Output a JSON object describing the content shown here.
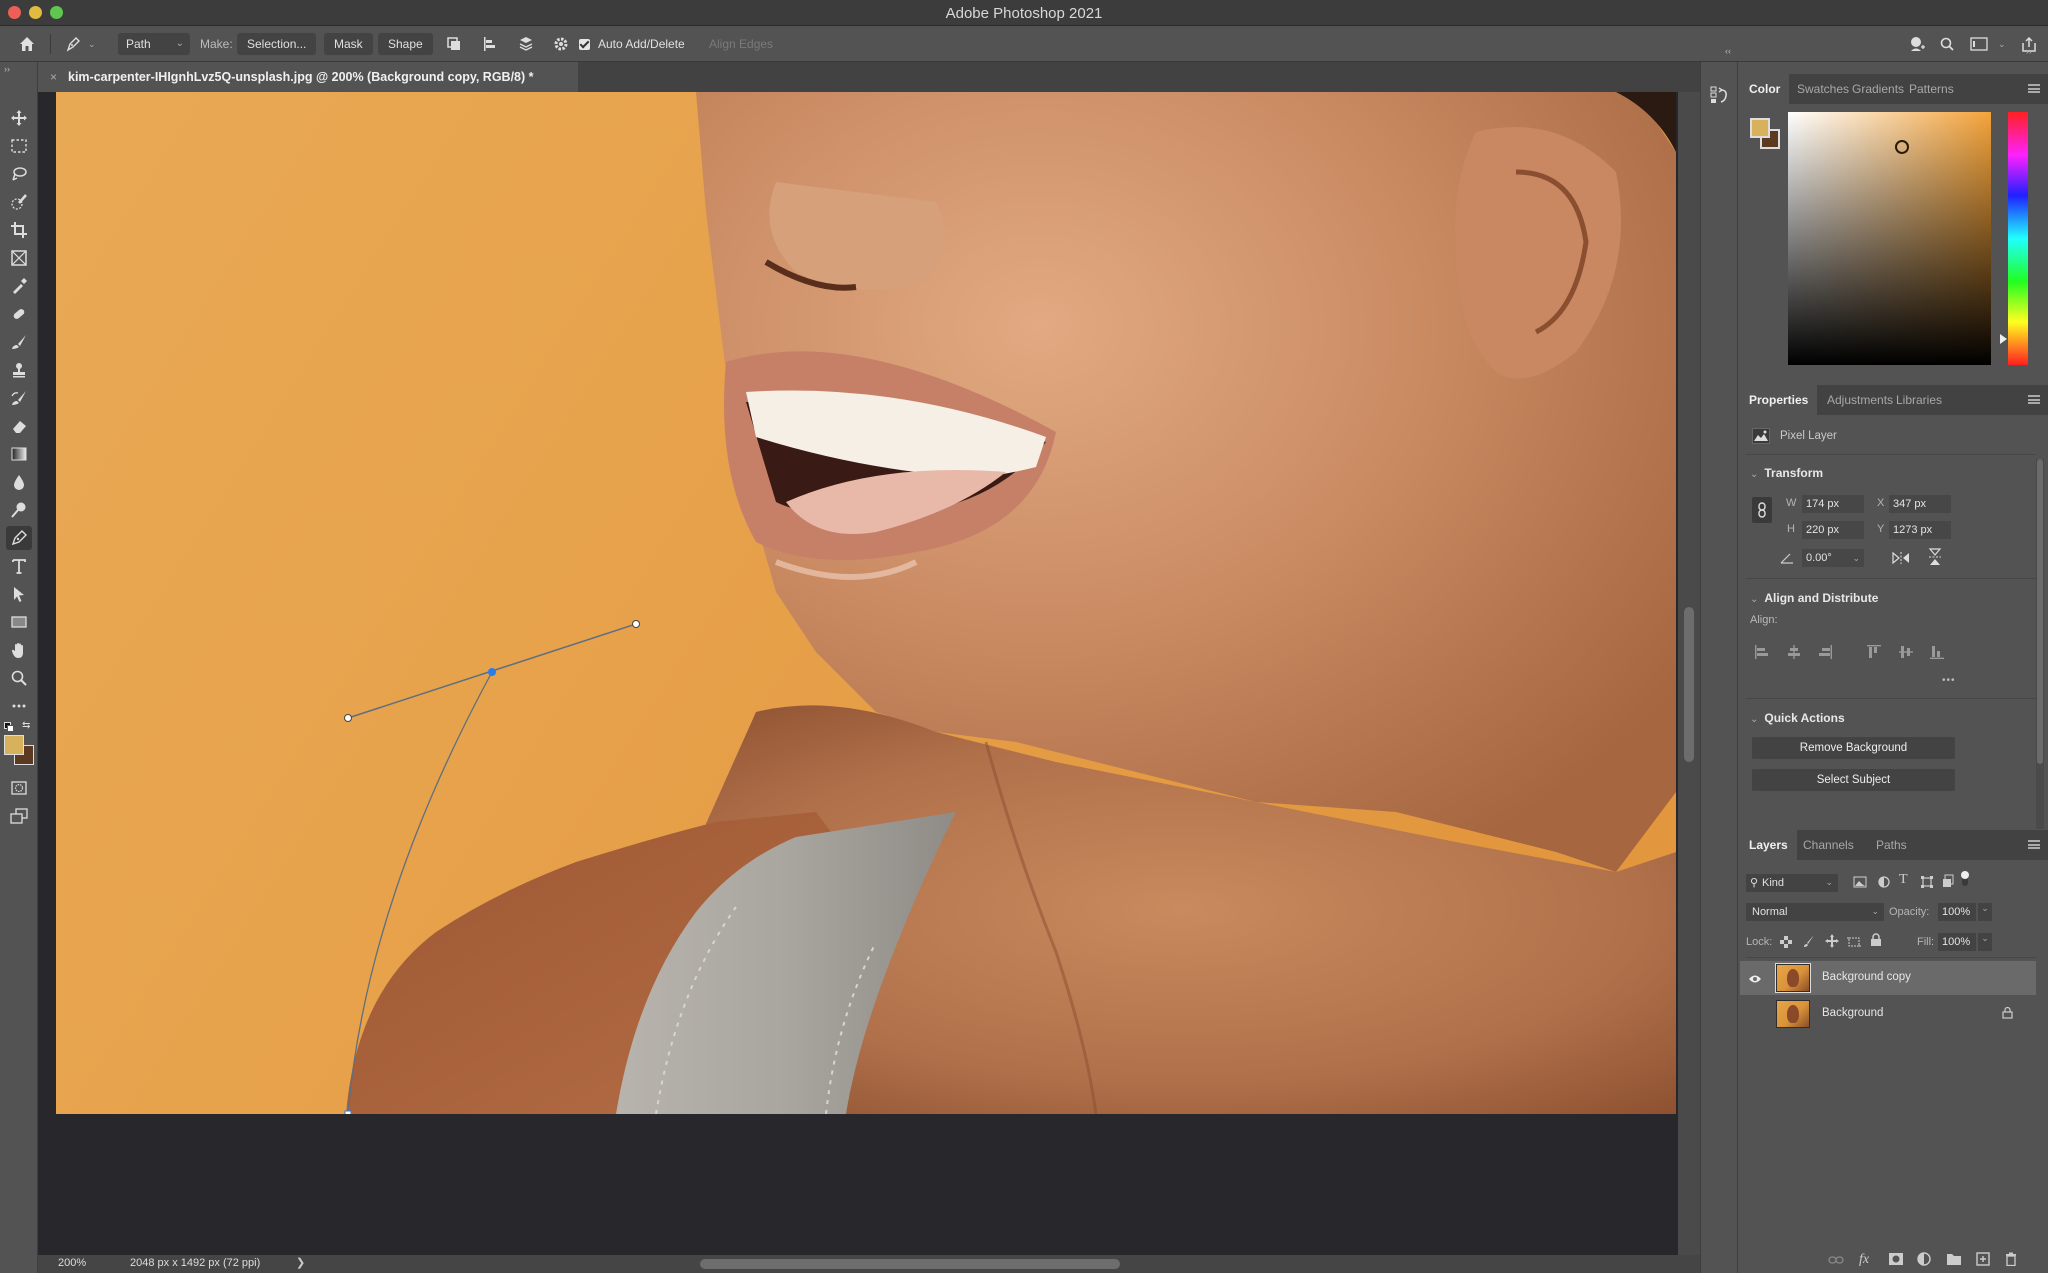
{
  "app": {
    "title": "Adobe Photoshop 2021"
  },
  "options_bar": {
    "tool_mode": "Path",
    "make_label": "Make:",
    "selection_label": "Selection...",
    "mask_label": "Mask",
    "shape_label": "Shape",
    "auto_add_delete_label": "Auto Add/Delete",
    "auto_add_delete_checked": true,
    "align_edges_label": "Align Edges"
  },
  "document": {
    "tab_title": "kim-carpenter-IHIgnhLvz5Q-unsplash.jpg @ 200% (Background copy, RGB/8) *",
    "zoom": "200%",
    "info": "2048 px x 1492 px (72 ppi)",
    "info_arrow": "❯"
  },
  "toolbar": {
    "active_tool": "pen",
    "tools": [
      "move",
      "marquee",
      "lasso",
      "quick-selection",
      "crop",
      "frame",
      "eyedropper",
      "healing-brush",
      "brush",
      "clone-stamp",
      "history-brush",
      "eraser",
      "gradient",
      "blur",
      "dodge",
      "pen",
      "type",
      "path-selection",
      "rectangle",
      "hand",
      "zoom",
      "more"
    ],
    "foreground_color": "#d8b15c",
    "background_color": "#5b3a21"
  },
  "color_panel": {
    "tabs": [
      "Color",
      "Swatches",
      "Gradients",
      "Patterns"
    ],
    "active_tab": "Color",
    "foreground_color": "#d8b15c",
    "background_color": "#5b3a21",
    "hue_color": "#f4a33a"
  },
  "properties_panel": {
    "tabs": [
      "Properties",
      "Adjustments",
      "Libraries"
    ],
    "active_tab": "Properties",
    "layer_type": "Pixel Layer",
    "transform": {
      "title": "Transform",
      "w_label": "W",
      "w": "174 px",
      "h_label": "H",
      "h": "220 px",
      "x_label": "X",
      "x": "347 px",
      "y_label": "Y",
      "y": "1273 px",
      "angle": "0.00°"
    },
    "align": {
      "title": "Align and Distribute",
      "align_label": "Align:",
      "more": "•••"
    },
    "quick_actions": {
      "title": "Quick Actions",
      "remove_background": "Remove Background",
      "select_subject": "Select Subject"
    }
  },
  "layers_panel": {
    "tabs": [
      "Layers",
      "Channels",
      "Paths"
    ],
    "active_tab": "Layers",
    "filter_kind": "Kind",
    "blend_mode": "Normal",
    "opacity_label": "Opacity:",
    "opacity": "100%",
    "lock_label": "Lock:",
    "fill_label": "Fill:",
    "fill": "100%",
    "layers": [
      {
        "name": "Background copy",
        "visible": true,
        "selected": true,
        "locked": false
      },
      {
        "name": "Background",
        "visible": false,
        "selected": false,
        "locked": true
      }
    ]
  }
}
